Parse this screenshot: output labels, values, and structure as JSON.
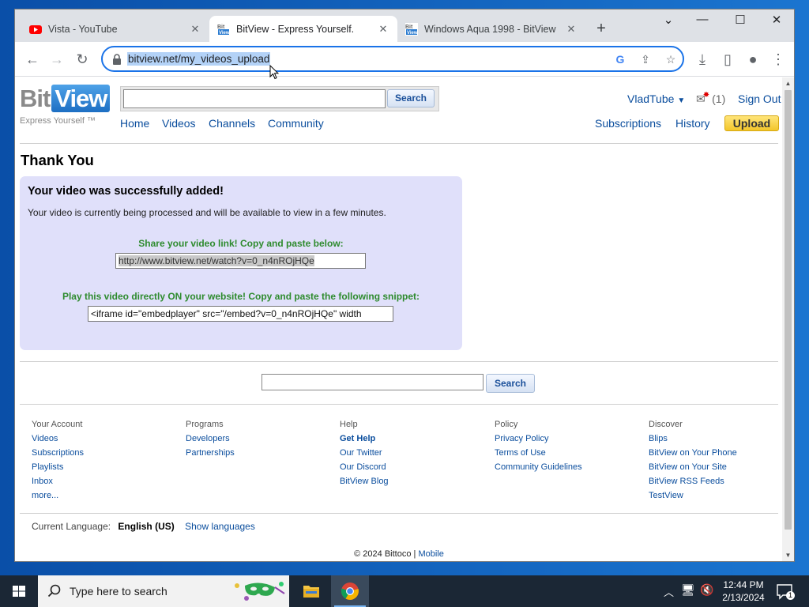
{
  "browser": {
    "tabs": [
      {
        "title": "Vista - YouTube",
        "icon": "youtube-icon",
        "active": false
      },
      {
        "title": "BitView - Express Yourself.",
        "icon": "bitview-icon",
        "active": true
      },
      {
        "title": "Windows Aqua 1998 - BitView",
        "icon": "bitview-icon",
        "active": false
      }
    ],
    "new_tab": "+",
    "url": "bitview.net/my_videos_upload"
  },
  "site": {
    "logo_bit": "Bit",
    "logo_view": "View",
    "tagline": "Express Yourself ™",
    "search_button": "Search",
    "nav": [
      "Home",
      "Videos",
      "Channels",
      "Community"
    ],
    "user": "VladTube",
    "inbox_count": "(1)",
    "sign_out": "Sign Out",
    "right_nav": [
      "Subscriptions",
      "History"
    ],
    "upload": "Upload"
  },
  "main": {
    "title": "Thank You",
    "success_heading": "Your video was successfully added!",
    "processing_msg": "Your video is currently being processed and will be available to view in a few minutes.",
    "share_label": "Share your video link! Copy and paste below:",
    "share_link": "http://www.bitview.net/watch?v=0_n4nROjHQe",
    "embed_label": "Play this video directly ON your website! Copy and paste the following snippet:",
    "embed_code": "<iframe id=\"embedplayer\" src=\"/embed?v=0_n4nROjHQe\" width",
    "bottom_search_button": "Search"
  },
  "footer": {
    "columns": [
      {
        "heading": "Your Account",
        "links": [
          "Videos",
          "Subscriptions",
          "Playlists",
          "Inbox",
          "more..."
        ]
      },
      {
        "heading": "Programs",
        "links": [
          "Developers",
          "Partnerships"
        ]
      },
      {
        "heading": "Help",
        "links": [
          "Get Help",
          "Our Twitter",
          "Our Discord",
          "BitView Blog"
        ]
      },
      {
        "heading": "Policy",
        "links": [
          "Privacy Policy",
          "Terms of Use",
          "Community Guidelines"
        ]
      },
      {
        "heading": "Discover",
        "links": [
          "Blips",
          "BitView on Your Phone",
          "BitView on Your Site",
          "BitView RSS Feeds",
          "TestView"
        ]
      }
    ],
    "language_label": "Current Language:",
    "language": "English (US)",
    "show_languages": "Show languages",
    "copyright": "© 2024 Bittoco",
    "mobile": "Mobile"
  },
  "taskbar": {
    "search_placeholder": "Type here to search",
    "time": "12:44 PM",
    "date": "2/13/2024",
    "notification_count": "1"
  }
}
